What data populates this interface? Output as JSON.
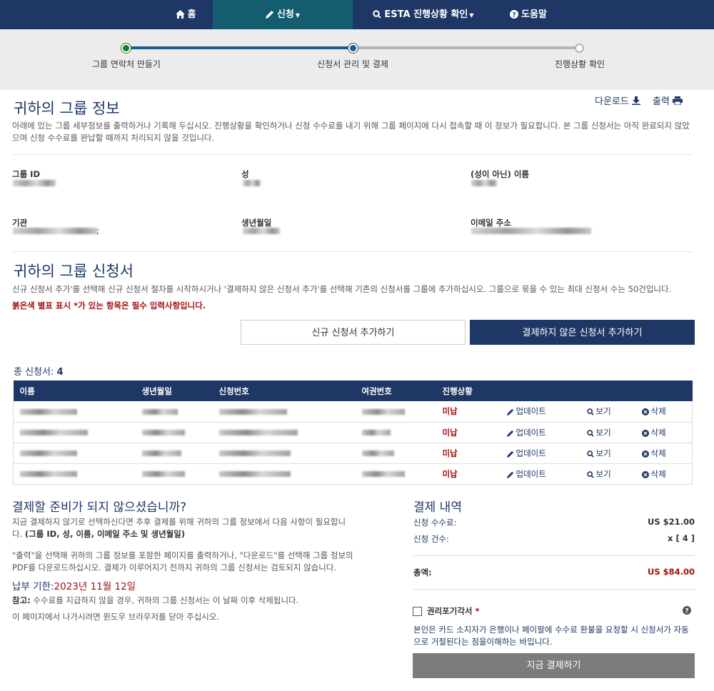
{
  "nav": {
    "home": "홈",
    "apply": "신청",
    "status": "ESTA 진행상황 확인",
    "help": "도움말"
  },
  "steps": [
    "그룹 연락처 만들기",
    "신청서 관리 및 결제",
    "진행상황 확인"
  ],
  "group_info": {
    "title": "귀하의 그룹 정보",
    "download": "다운로드",
    "print": "출력",
    "description": "아래에 있는 그룹 세부정보를 출력하거나 기록해 두십시오. 진행상황을 확인하거나 신청 수수료를 내기 위해 그룹 페이지에 다시 접속할 때 이 정보가 필요합니다. 본 그룹 신청서는 아직 완료되지 않았으며 신청 수수료를 완납할 때까지 처리되지 않을 것입니다.",
    "labels": {
      "group_id": "그룹 ID",
      "surname": "성",
      "given_name": "(성이 아닌) 이름",
      "organization": "기관",
      "dob": "생년월일",
      "email": "이메일 주소"
    },
    "org_suffix": ";"
  },
  "applications": {
    "title": "귀하의 그룹 신청서",
    "description": "신규 신청서 추가'를 선택해 신규 신청서 절차를 시작하시거나 '결제하지 않은 신청서 추가'를 선택해 기존의 신청서를 그룹에 추가하십시오. 그룹으로 묶을 수 있는 최대 신청서 수는 50건입니다.",
    "required_note": "붉은색 별표 표시 *가 있는 항목은 필수 입력사항입니다.",
    "btn_new": "신규 신청서 추가하기",
    "btn_unpaid": "결제하지 않은 신청서 추가하기",
    "total_label": "총 신청서:",
    "total_count": "4",
    "columns": [
      "이름",
      "생년월일",
      "신청번호",
      "여권번호",
      "진행상황",
      "",
      ""
    ],
    "rows": [
      {
        "status": "미납",
        "update": "업데이트",
        "view": "보기",
        "delete": "삭제"
      },
      {
        "status": "미납",
        "update": "업데이트",
        "view": "보기",
        "delete": "삭제"
      },
      {
        "status": "미납",
        "update": "업데이트",
        "view": "보기",
        "delete": "삭제"
      },
      {
        "status": "미납",
        "update": "업데이트",
        "view": "보기",
        "delete": "삭제"
      }
    ]
  },
  "not_ready": {
    "title": "결제할 준비가 되지 않으셨습니까?",
    "p1": "지금 결제하지 않기로 선택하신다면 추후 결제를 위해 귀하의 그룹 정보에서 다음 사항이 필요합니다.",
    "p1_bold": "(그룹 ID, 성, 이름, 이메일 주소 및 생년월일)",
    "p2": "\"출력\"을 선택해 귀하의 그룹 정보를 포함한 페이지를 출력하거나, \"다운로드\"를 선택해 그룹 정보의 PDF를 다운로드하십시오. 결제가 이루어지기 전까지 귀하의 그룹 신청서는 검토되지 않습니다.",
    "due_label": "납부 기한:",
    "due_date": "2023년 11월 12일",
    "note_label": "참고:",
    "note": "수수료를 지급하지 않을 경우, 귀하의 그룹 신청서는 이 날짜 이후 삭제됩니다.",
    "close_note": "이 페이지에서 나가시려면 윈도우 브라우저를 닫아 주십시오."
  },
  "payment": {
    "title": "결제 내역",
    "fee_label": "신청 수수료:",
    "fee_value": "US $21.00",
    "count_label": "신청 건수:",
    "count_value": "x [ 4 ]",
    "total_label": "총액:",
    "total_value": "US $84.00",
    "waiver_label": "권리포기각서",
    "waiver_star": "*",
    "waiver_text": "본인은 카드 소지자가 은행이나 페이팔에 수수료 환불을 요청할 시 신청서가 자동으로 거절된다는 점을이해하는 바입니다.",
    "pay_button": "지금 결제하기"
  },
  "colors": {
    "navy": "#1f3765",
    "teal": "#135d6e",
    "red": "#a50f0f",
    "green": "#1a7a2c"
  }
}
